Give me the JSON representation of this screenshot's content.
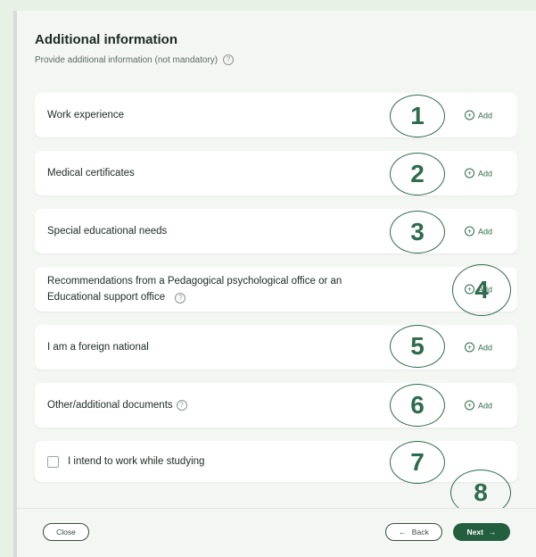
{
  "header": {
    "title": "Additional information",
    "subtitle": "Provide additional information (not mandatory)"
  },
  "cards": [
    {
      "label": "Work experience",
      "action": "Add"
    },
    {
      "label": "Medical certificates",
      "action": "Add"
    },
    {
      "label": "Special educational needs",
      "action": "Add"
    },
    {
      "label_line1": "Recommendations from a Pedagogical psychological office or an",
      "label_line2": "Educational support office",
      "action": "Add"
    },
    {
      "label": "I am a foreign national",
      "action": "Add"
    },
    {
      "label": "Other/additional documents",
      "action": "Add"
    }
  ],
  "checkbox": {
    "label": "I intend to work while studying",
    "checked": false
  },
  "markers": [
    "1",
    "2",
    "3",
    "4",
    "5",
    "6",
    "7",
    "8"
  ],
  "footer": {
    "close_label": "Close",
    "back_label": "Back",
    "next_label": "Next"
  },
  "colors": {
    "accent": "#2f6b4e",
    "primary_button": "#235e3f",
    "background": "#e8f1e6"
  }
}
